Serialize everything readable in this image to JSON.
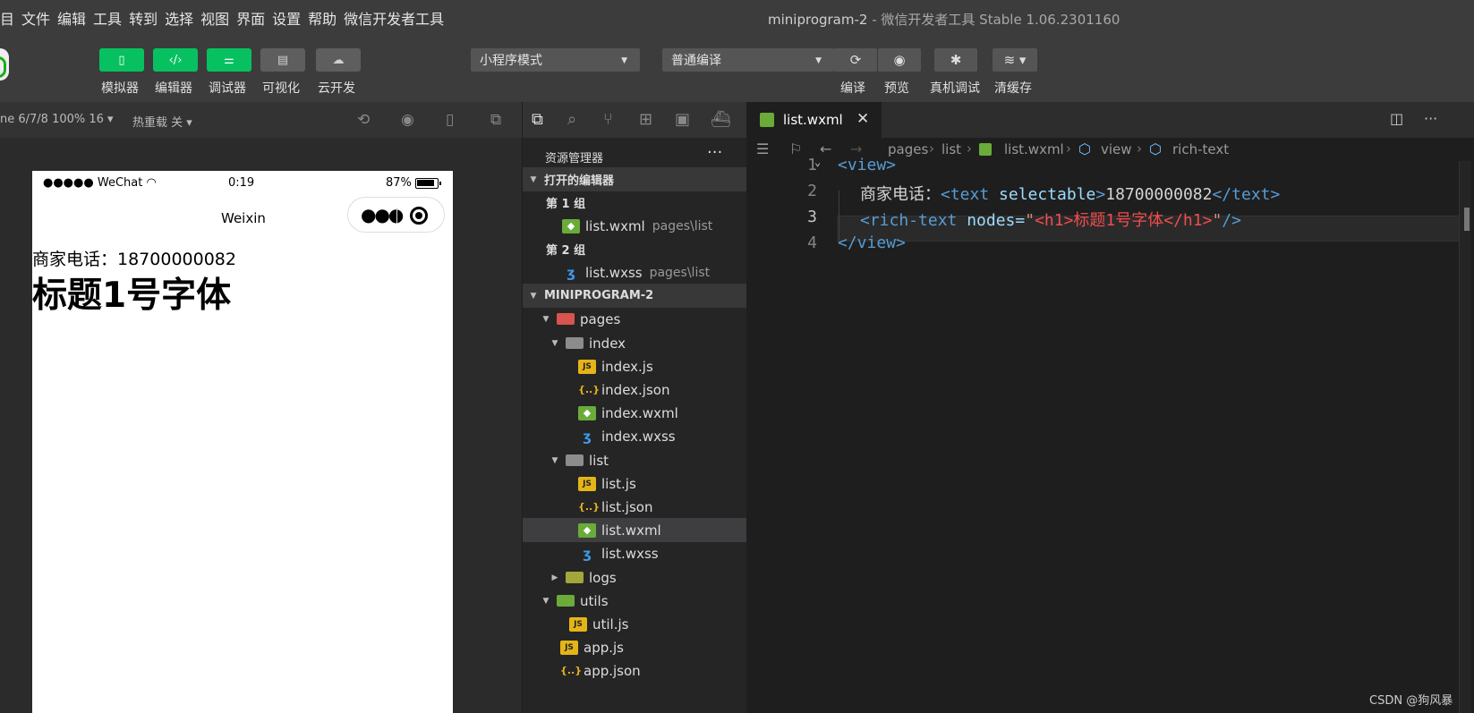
{
  "menu": [
    "目",
    "文件",
    "编辑",
    "工具",
    "转到",
    "选择",
    "视图",
    "界面",
    "设置",
    "帮助",
    "微信开发者工具"
  ],
  "window_title": {
    "project": "miniprogram-2",
    "rest": " - 微信开发者工具 Stable 1.06.2301160"
  },
  "toolbar": {
    "simulator": "模拟器",
    "editor": "编辑器",
    "debugger": "调试器",
    "visual": "可视化",
    "cloud": "云开发",
    "mode_select": "小程序模式",
    "compile_select": "普通编译",
    "compile": "编译",
    "preview": "预览",
    "real_debug": "真机调试",
    "clear_cache": "清缓存"
  },
  "simulator": {
    "device": "ne 6/7/8 100% 16 ▾",
    "hot_reload": "热重载 关 ▾",
    "status_carrier": "●●●●● WeChat",
    "status_time": "0:19",
    "status_battery": "87%",
    "nav_title": "Weixin",
    "content_line": "商家电话：18700000082",
    "content_h1": "标题1号字体"
  },
  "explorer": {
    "title": "资源管理器",
    "open_editors": "打开的编辑器",
    "group1": "第 1 组",
    "group1_file": "list.wxml",
    "group1_path": "pages\\list",
    "group2": "第 2 组",
    "group2_file": "list.wxss",
    "group2_path": "pages\\list",
    "project": "MINIPROGRAM-2",
    "tree": {
      "pages": "pages",
      "index": "index",
      "index_js": "index.js",
      "index_json": "index.json",
      "index_wxml": "index.wxml",
      "index_wxss": "index.wxss",
      "list": "list",
      "list_js": "list.js",
      "list_json": "list.json",
      "list_wxml": "list.wxml",
      "list_wxss": "list.wxss",
      "logs": "logs",
      "utils": "utils",
      "util_js": "util.js",
      "app_js": "app.js",
      "app_json": "app.json"
    }
  },
  "editor": {
    "tab": "list.wxml",
    "breadcrumb": [
      "pages",
      "list",
      "list.wxml",
      "view",
      "rich-text"
    ],
    "line_numbers": [
      "1",
      "2",
      "3",
      "4"
    ],
    "code": {
      "l1_tag": "<view>",
      "l2_text": "商家电话：",
      "l2_open": "<text",
      "l2_attr": " selectable",
      "l2_close_bracket": ">",
      "l2_value": "18700000082",
      "l2_end": "</text>",
      "l3_open": "<rich-text",
      "l3_attr": " nodes=",
      "l3_quote": "\"",
      "l3_str": "<h1>标题1号字体</h1>",
      "l3_end_quote": "\"",
      "l3_close": "/>",
      "l4_tag": "</view>"
    }
  },
  "watermark": "CSDN @狗风暴"
}
